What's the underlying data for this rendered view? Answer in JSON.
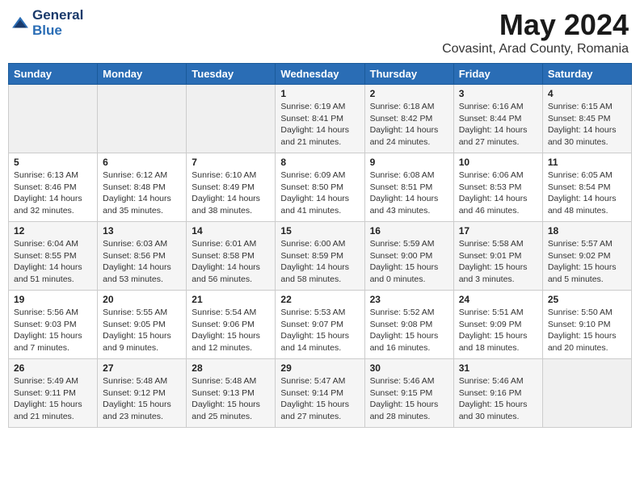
{
  "logo": {
    "line1": "General",
    "line2": "Blue"
  },
  "title": "May 2024",
  "subtitle": "Covasint, Arad County, Romania",
  "days_header": [
    "Sunday",
    "Monday",
    "Tuesday",
    "Wednesday",
    "Thursday",
    "Friday",
    "Saturday"
  ],
  "weeks": [
    [
      {
        "day": "",
        "info": ""
      },
      {
        "day": "",
        "info": ""
      },
      {
        "day": "",
        "info": ""
      },
      {
        "day": "1",
        "info": "Sunrise: 6:19 AM\nSunset: 8:41 PM\nDaylight: 14 hours\nand 21 minutes."
      },
      {
        "day": "2",
        "info": "Sunrise: 6:18 AM\nSunset: 8:42 PM\nDaylight: 14 hours\nand 24 minutes."
      },
      {
        "day": "3",
        "info": "Sunrise: 6:16 AM\nSunset: 8:44 PM\nDaylight: 14 hours\nand 27 minutes."
      },
      {
        "day": "4",
        "info": "Sunrise: 6:15 AM\nSunset: 8:45 PM\nDaylight: 14 hours\nand 30 minutes."
      }
    ],
    [
      {
        "day": "5",
        "info": "Sunrise: 6:13 AM\nSunset: 8:46 PM\nDaylight: 14 hours\nand 32 minutes."
      },
      {
        "day": "6",
        "info": "Sunrise: 6:12 AM\nSunset: 8:48 PM\nDaylight: 14 hours\nand 35 minutes."
      },
      {
        "day": "7",
        "info": "Sunrise: 6:10 AM\nSunset: 8:49 PM\nDaylight: 14 hours\nand 38 minutes."
      },
      {
        "day": "8",
        "info": "Sunrise: 6:09 AM\nSunset: 8:50 PM\nDaylight: 14 hours\nand 41 minutes."
      },
      {
        "day": "9",
        "info": "Sunrise: 6:08 AM\nSunset: 8:51 PM\nDaylight: 14 hours\nand 43 minutes."
      },
      {
        "day": "10",
        "info": "Sunrise: 6:06 AM\nSunset: 8:53 PM\nDaylight: 14 hours\nand 46 minutes."
      },
      {
        "day": "11",
        "info": "Sunrise: 6:05 AM\nSunset: 8:54 PM\nDaylight: 14 hours\nand 48 minutes."
      }
    ],
    [
      {
        "day": "12",
        "info": "Sunrise: 6:04 AM\nSunset: 8:55 PM\nDaylight: 14 hours\nand 51 minutes."
      },
      {
        "day": "13",
        "info": "Sunrise: 6:03 AM\nSunset: 8:56 PM\nDaylight: 14 hours\nand 53 minutes."
      },
      {
        "day": "14",
        "info": "Sunrise: 6:01 AM\nSunset: 8:58 PM\nDaylight: 14 hours\nand 56 minutes."
      },
      {
        "day": "15",
        "info": "Sunrise: 6:00 AM\nSunset: 8:59 PM\nDaylight: 14 hours\nand 58 minutes."
      },
      {
        "day": "16",
        "info": "Sunrise: 5:59 AM\nSunset: 9:00 PM\nDaylight: 15 hours\nand 0 minutes."
      },
      {
        "day": "17",
        "info": "Sunrise: 5:58 AM\nSunset: 9:01 PM\nDaylight: 15 hours\nand 3 minutes."
      },
      {
        "day": "18",
        "info": "Sunrise: 5:57 AM\nSunset: 9:02 PM\nDaylight: 15 hours\nand 5 minutes."
      }
    ],
    [
      {
        "day": "19",
        "info": "Sunrise: 5:56 AM\nSunset: 9:03 PM\nDaylight: 15 hours\nand 7 minutes."
      },
      {
        "day": "20",
        "info": "Sunrise: 5:55 AM\nSunset: 9:05 PM\nDaylight: 15 hours\nand 9 minutes."
      },
      {
        "day": "21",
        "info": "Sunrise: 5:54 AM\nSunset: 9:06 PM\nDaylight: 15 hours\nand 12 minutes."
      },
      {
        "day": "22",
        "info": "Sunrise: 5:53 AM\nSunset: 9:07 PM\nDaylight: 15 hours\nand 14 minutes."
      },
      {
        "day": "23",
        "info": "Sunrise: 5:52 AM\nSunset: 9:08 PM\nDaylight: 15 hours\nand 16 minutes."
      },
      {
        "day": "24",
        "info": "Sunrise: 5:51 AM\nSunset: 9:09 PM\nDaylight: 15 hours\nand 18 minutes."
      },
      {
        "day": "25",
        "info": "Sunrise: 5:50 AM\nSunset: 9:10 PM\nDaylight: 15 hours\nand 20 minutes."
      }
    ],
    [
      {
        "day": "26",
        "info": "Sunrise: 5:49 AM\nSunset: 9:11 PM\nDaylight: 15 hours\nand 21 minutes."
      },
      {
        "day": "27",
        "info": "Sunrise: 5:48 AM\nSunset: 9:12 PM\nDaylight: 15 hours\nand 23 minutes."
      },
      {
        "day": "28",
        "info": "Sunrise: 5:48 AM\nSunset: 9:13 PM\nDaylight: 15 hours\nand 25 minutes."
      },
      {
        "day": "29",
        "info": "Sunrise: 5:47 AM\nSunset: 9:14 PM\nDaylight: 15 hours\nand 27 minutes."
      },
      {
        "day": "30",
        "info": "Sunrise: 5:46 AM\nSunset: 9:15 PM\nDaylight: 15 hours\nand 28 minutes."
      },
      {
        "day": "31",
        "info": "Sunrise: 5:46 AM\nSunset: 9:16 PM\nDaylight: 15 hours\nand 30 minutes."
      },
      {
        "day": "",
        "info": ""
      }
    ]
  ]
}
